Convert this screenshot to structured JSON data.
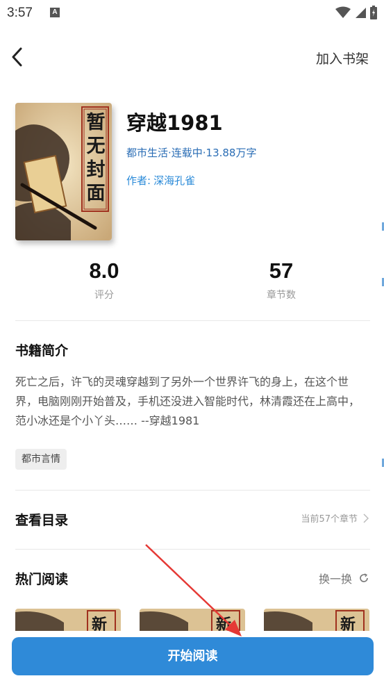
{
  "status_bar": {
    "time": "3:57",
    "notification_letter": "A"
  },
  "top_bar": {
    "add_to_shelf": "加入书架"
  },
  "book": {
    "title": "穿越1981",
    "meta": "都市生活·连载中·13.88万字",
    "author_label": "作者:",
    "author_name": "深海孔雀",
    "cover_text": [
      "暂",
      "无",
      "封",
      "面"
    ]
  },
  "stats": [
    {
      "value": "8.0",
      "label": "评分"
    },
    {
      "value": "57",
      "label": "章节数"
    }
  ],
  "intro": {
    "title": "书籍简介",
    "text": "死亡之后，许飞的灵魂穿越到了另外一个世界许飞的身上，在这个世界，电脑刚刚开始普及，手机还没进入智能时代，林清霞还在上高中，范小冰还是个小丫头…… --穿越1981",
    "tag": "都市言情"
  },
  "toc": {
    "title": "查看目录",
    "info": "当前57个章节"
  },
  "hot": {
    "title": "热门阅读",
    "swap_label": "换一换",
    "cover_char": "新"
  },
  "bottom": {
    "start_reading": "开始阅读"
  },
  "colors": {
    "accent": "#2f8ad8",
    "link": "#2a6db5",
    "annotation_arrow": "#e53935"
  },
  "icons": [
    "back-arrow-icon",
    "wifi-icon",
    "signal-icon",
    "battery-icon",
    "chevron-right-icon",
    "refresh-icon"
  ]
}
